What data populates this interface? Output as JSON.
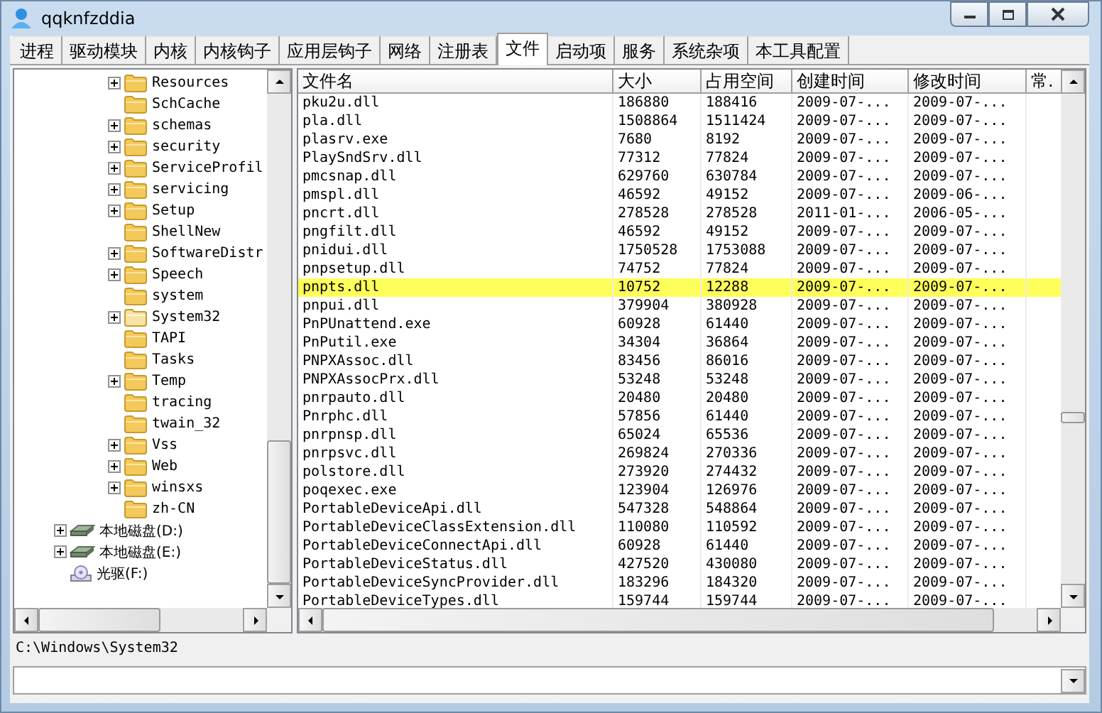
{
  "window": {
    "title": "qqknfzddia"
  },
  "tabs": [
    {
      "label": "进程",
      "selected": false
    },
    {
      "label": "驱动模块",
      "selected": false
    },
    {
      "label": "内核",
      "selected": false
    },
    {
      "label": "内核钩子",
      "selected": false
    },
    {
      "label": "应用层钩子",
      "selected": false
    },
    {
      "label": "网络",
      "selected": false
    },
    {
      "label": "注册表",
      "selected": false
    },
    {
      "label": "文件",
      "selected": true
    },
    {
      "label": "启动项",
      "selected": false
    },
    {
      "label": "服务",
      "selected": false
    },
    {
      "label": "系统杂项",
      "selected": false
    },
    {
      "label": "本工具配置",
      "selected": false
    }
  ],
  "tree": {
    "folders": [
      {
        "label": "Resources",
        "expandable": true,
        "selected": false
      },
      {
        "label": "SchCache",
        "expandable": false,
        "selected": false
      },
      {
        "label": "schemas",
        "expandable": true,
        "selected": false
      },
      {
        "label": "security",
        "expandable": true,
        "selected": false
      },
      {
        "label": "ServiceProfil",
        "expandable": true,
        "selected": false
      },
      {
        "label": "servicing",
        "expandable": true,
        "selected": false
      },
      {
        "label": "Setup",
        "expandable": true,
        "selected": false
      },
      {
        "label": "ShellNew",
        "expandable": false,
        "selected": false
      },
      {
        "label": "SoftwareDistr",
        "expandable": true,
        "selected": false
      },
      {
        "label": "Speech",
        "expandable": true,
        "selected": false
      },
      {
        "label": "system",
        "expandable": false,
        "selected": false
      },
      {
        "label": "System32",
        "expandable": true,
        "selected": true
      },
      {
        "label": "TAPI",
        "expandable": false,
        "selected": false
      },
      {
        "label": "Tasks",
        "expandable": false,
        "selected": false
      },
      {
        "label": "Temp",
        "expandable": true,
        "selected": false
      },
      {
        "label": "tracing",
        "expandable": false,
        "selected": false
      },
      {
        "label": "twain_32",
        "expandable": false,
        "selected": false
      },
      {
        "label": "Vss",
        "expandable": true,
        "selected": false
      },
      {
        "label": "Web",
        "expandable": true,
        "selected": false
      },
      {
        "label": "winsxs",
        "expandable": true,
        "selected": false
      },
      {
        "label": "zh-CN",
        "expandable": false,
        "selected": false
      }
    ],
    "drives": [
      {
        "label": "本地磁盘(D:)",
        "kind": "disk",
        "expandable": true
      },
      {
        "label": "本地磁盘(E:)",
        "kind": "disk",
        "expandable": true
      },
      {
        "label": "光驱(F:)",
        "kind": "cdrom",
        "expandable": false
      }
    ]
  },
  "table": {
    "columns": [
      "文件名",
      "大小",
      "占用空间",
      "创建时间",
      "修改时间",
      "常."
    ],
    "rows": [
      {
        "cells": [
          "pku2u.dll",
          "186880",
          "188416",
          "2009-07-...",
          "2009-07-..."
        ],
        "selected": false
      },
      {
        "cells": [
          "pla.dll",
          "1508864",
          "1511424",
          "2009-07-...",
          "2009-07-..."
        ],
        "selected": false
      },
      {
        "cells": [
          "plasrv.exe",
          "7680",
          "8192",
          "2009-07-...",
          "2009-07-..."
        ],
        "selected": false
      },
      {
        "cells": [
          "PlaySndSrv.dll",
          "77312",
          "77824",
          "2009-07-...",
          "2009-07-..."
        ],
        "selected": false
      },
      {
        "cells": [
          "pmcsnap.dll",
          "629760",
          "630784",
          "2009-07-...",
          "2009-07-..."
        ],
        "selected": false
      },
      {
        "cells": [
          "pmspl.dll",
          "46592",
          "49152",
          "2009-07-...",
          "2009-06-..."
        ],
        "selected": false
      },
      {
        "cells": [
          "pncrt.dll",
          "278528",
          "278528",
          "2011-01-...",
          "2006-05-..."
        ],
        "selected": false
      },
      {
        "cells": [
          "pngfilt.dll",
          "46592",
          "49152",
          "2009-07-...",
          "2009-07-..."
        ],
        "selected": false
      },
      {
        "cells": [
          "pnidui.dll",
          "1750528",
          "1753088",
          "2009-07-...",
          "2009-07-..."
        ],
        "selected": false
      },
      {
        "cells": [
          "pnpsetup.dll",
          "74752",
          "77824",
          "2009-07-...",
          "2009-07-..."
        ],
        "selected": false
      },
      {
        "cells": [
          "pnpts.dll",
          "10752",
          "12288",
          "2009-07-...",
          "2009-07-..."
        ],
        "selected": true
      },
      {
        "cells": [
          "pnpui.dll",
          "379904",
          "380928",
          "2009-07-...",
          "2009-07-..."
        ],
        "selected": false
      },
      {
        "cells": [
          "PnPUnattend.exe",
          "60928",
          "61440",
          "2009-07-...",
          "2009-07-..."
        ],
        "selected": false
      },
      {
        "cells": [
          "PnPutil.exe",
          "34304",
          "36864",
          "2009-07-...",
          "2009-07-..."
        ],
        "selected": false
      },
      {
        "cells": [
          "PNPXAssoc.dll",
          "83456",
          "86016",
          "2009-07-...",
          "2009-07-..."
        ],
        "selected": false
      },
      {
        "cells": [
          "PNPXAssocPrx.dll",
          "53248",
          "53248",
          "2009-07-...",
          "2009-07-..."
        ],
        "selected": false
      },
      {
        "cells": [
          "pnrpauto.dll",
          "20480",
          "20480",
          "2009-07-...",
          "2009-07-..."
        ],
        "selected": false
      },
      {
        "cells": [
          "Pnrphc.dll",
          "57856",
          "61440",
          "2009-07-...",
          "2009-07-..."
        ],
        "selected": false
      },
      {
        "cells": [
          "pnrpnsp.dll",
          "65024",
          "65536",
          "2009-07-...",
          "2009-07-..."
        ],
        "selected": false
      },
      {
        "cells": [
          "pnrpsvc.dll",
          "269824",
          "270336",
          "2009-07-...",
          "2009-07-..."
        ],
        "selected": false
      },
      {
        "cells": [
          "polstore.dll",
          "273920",
          "274432",
          "2009-07-...",
          "2009-07-..."
        ],
        "selected": false
      },
      {
        "cells": [
          "poqexec.exe",
          "123904",
          "126976",
          "2009-07-...",
          "2009-07-..."
        ],
        "selected": false
      },
      {
        "cells": [
          "PortableDeviceApi.dll",
          "547328",
          "548864",
          "2009-07-...",
          "2009-07-..."
        ],
        "selected": false
      },
      {
        "cells": [
          "PortableDeviceClassExtension.dll",
          "110080",
          "110592",
          "2009-07-...",
          "2009-07-..."
        ],
        "selected": false
      },
      {
        "cells": [
          "PortableDeviceConnectApi.dll",
          "60928",
          "61440",
          "2009-07-...",
          "2009-07-..."
        ],
        "selected": false
      },
      {
        "cells": [
          "PortableDeviceStatus.dll",
          "427520",
          "430080",
          "2009-07-...",
          "2009-07-..."
        ],
        "selected": false
      },
      {
        "cells": [
          "PortableDeviceSyncProvider.dll",
          "183296",
          "184320",
          "2009-07-...",
          "2009-07-..."
        ],
        "selected": false
      },
      {
        "cells": [
          "PortableDeviceTypes.dll",
          "159744",
          "159744",
          "2009-07-...",
          "2009-07-..."
        ],
        "selected": false
      }
    ]
  },
  "path": "C:\\Windows\\System32"
}
